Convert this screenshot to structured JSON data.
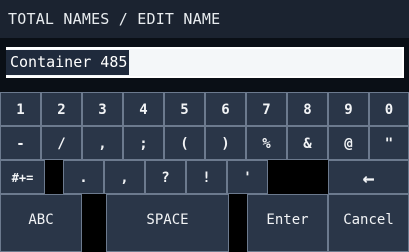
{
  "title": "TOTAL NAMES / EDIT NAME",
  "input": {
    "value": "Container 485"
  },
  "rows": {
    "r1": [
      "1",
      "2",
      "3",
      "4",
      "5",
      "6",
      "7",
      "8",
      "9",
      "0"
    ],
    "r2": [
      "-",
      "/",
      ",",
      ";",
      "(",
      ")",
      "%",
      "&",
      "@",
      "\""
    ],
    "r3": {
      "symbols": "#+=",
      "keys": [
        ".",
        ",",
        "?",
        "!",
        "'"
      ],
      "backspace": "←"
    },
    "r4": {
      "abc": "ABC",
      "space": "SPACE",
      "enter": "Enter",
      "cancel": "Cancel"
    }
  },
  "colors": {
    "key_bg": "#2a3648",
    "key_border": "#6c7a8e",
    "bg": "#0a0f16",
    "title_bg": "#1b2330"
  }
}
